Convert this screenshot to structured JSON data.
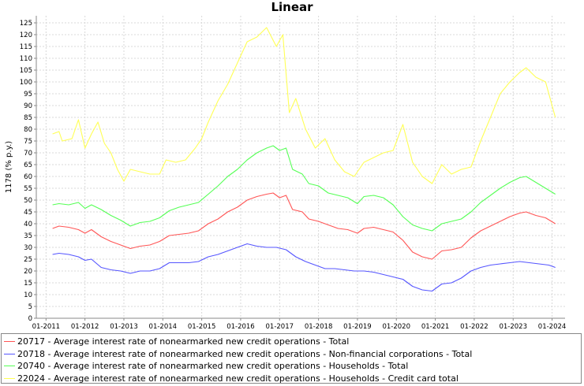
{
  "chart_data": {
    "type": "line",
    "title": "Linear",
    "xlabel": "",
    "ylabel": "1178 (% p.y.)",
    "ylim": [
      0,
      128
    ],
    "yticks": [
      0,
      5,
      10,
      15,
      20,
      25,
      30,
      35,
      40,
      45,
      50,
      55,
      60,
      65,
      70,
      75,
      80,
      85,
      90,
      95,
      100,
      105,
      110,
      115,
      120,
      125
    ],
    "xlim": [
      "2010-10",
      "2024-05"
    ],
    "xticks": [
      "01-2011",
      "01-2012",
      "01-2013",
      "01-2014",
      "01-2015",
      "01-2016",
      "01-2017",
      "01-2018",
      "01-2019",
      "01-2020",
      "01-2021",
      "01-2022",
      "01-2023",
      "01-2024"
    ],
    "grid": true,
    "legend_position": "bottom",
    "series": [
      {
        "name": "20717 - Average interest rate of nonearmarked new credit operations - Total",
        "color": "#ff5555",
        "points": [
          [
            "2011-03",
            38.0
          ],
          [
            "2011-05",
            39.0
          ],
          [
            "2011-08",
            38.5
          ],
          [
            "2011-11",
            37.5
          ],
          [
            "2012-01",
            36.0
          ],
          [
            "2012-03",
            37.5
          ],
          [
            "2012-06",
            34.5
          ],
          [
            "2012-09",
            32.5
          ],
          [
            "2012-12",
            31.0
          ],
          [
            "2013-03",
            29.5
          ],
          [
            "2013-06",
            30.5
          ],
          [
            "2013-09",
            31.0
          ],
          [
            "2013-12",
            32.5
          ],
          [
            "2014-03",
            35.0
          ],
          [
            "2014-06",
            35.5
          ],
          [
            "2014-09",
            36.0
          ],
          [
            "2014-12",
            37.0
          ],
          [
            "2015-03",
            40.0
          ],
          [
            "2015-06",
            42.0
          ],
          [
            "2015-09",
            45.0
          ],
          [
            "2015-12",
            47.0
          ],
          [
            "2016-03",
            50.0
          ],
          [
            "2016-06",
            51.5
          ],
          [
            "2016-09",
            52.5
          ],
          [
            "2016-11",
            53.0
          ],
          [
            "2017-01",
            51.0
          ],
          [
            "2017-03",
            52.0
          ],
          [
            "2017-05",
            46.0
          ],
          [
            "2017-08",
            45.0
          ],
          [
            "2017-10",
            42.0
          ],
          [
            "2018-01",
            41.0
          ],
          [
            "2018-04",
            39.5
          ],
          [
            "2018-07",
            38.0
          ],
          [
            "2018-10",
            37.5
          ],
          [
            "2019-01",
            36.0
          ],
          [
            "2019-03",
            38.0
          ],
          [
            "2019-06",
            38.5
          ],
          [
            "2019-09",
            37.5
          ],
          [
            "2019-12",
            36.5
          ],
          [
            "2020-03",
            33.0
          ],
          [
            "2020-06",
            28.0
          ],
          [
            "2020-09",
            26.0
          ],
          [
            "2020-12",
            25.0
          ],
          [
            "2021-03",
            28.5
          ],
          [
            "2021-06",
            29.0
          ],
          [
            "2021-09",
            30.0
          ],
          [
            "2021-12",
            34.0
          ],
          [
            "2022-03",
            37.0
          ],
          [
            "2022-06",
            39.0
          ],
          [
            "2022-09",
            41.0
          ],
          [
            "2022-12",
            43.0
          ],
          [
            "2023-03",
            44.5
          ],
          [
            "2023-05",
            45.0
          ],
          [
            "2023-08",
            43.5
          ],
          [
            "2023-11",
            42.5
          ],
          [
            "2024-02",
            40.0
          ]
        ]
      },
      {
        "name": "20718 - Average interest rate of nonearmarked new credit operations - Non-financial corporations - Total",
        "color": "#5555ff",
        "points": [
          [
            "2011-03",
            27.0
          ],
          [
            "2011-05",
            27.5
          ],
          [
            "2011-08",
            27.0
          ],
          [
            "2011-11",
            26.0
          ],
          [
            "2012-01",
            24.5
          ],
          [
            "2012-03",
            25.0
          ],
          [
            "2012-06",
            21.5
          ],
          [
            "2012-09",
            20.5
          ],
          [
            "2012-12",
            20.0
          ],
          [
            "2013-03",
            19.0
          ],
          [
            "2013-06",
            20.0
          ],
          [
            "2013-09",
            20.0
          ],
          [
            "2013-12",
            21.0
          ],
          [
            "2014-03",
            23.5
          ],
          [
            "2014-06",
            23.5
          ],
          [
            "2014-09",
            23.5
          ],
          [
            "2014-12",
            24.0
          ],
          [
            "2015-03",
            26.0
          ],
          [
            "2015-06",
            27.0
          ],
          [
            "2015-09",
            28.5
          ],
          [
            "2015-12",
            30.0
          ],
          [
            "2016-03",
            31.5
          ],
          [
            "2016-06",
            30.5
          ],
          [
            "2016-09",
            30.0
          ],
          [
            "2016-12",
            30.0
          ],
          [
            "2017-03",
            29.0
          ],
          [
            "2017-06",
            26.0
          ],
          [
            "2017-09",
            24.0
          ],
          [
            "2017-12",
            22.5
          ],
          [
            "2018-03",
            21.0
          ],
          [
            "2018-06",
            21.0
          ],
          [
            "2018-09",
            20.5
          ],
          [
            "2018-12",
            20.0
          ],
          [
            "2019-03",
            20.0
          ],
          [
            "2019-06",
            19.5
          ],
          [
            "2019-09",
            18.5
          ],
          [
            "2019-12",
            17.5
          ],
          [
            "2020-03",
            16.5
          ],
          [
            "2020-06",
            13.5
          ],
          [
            "2020-09",
            12.0
          ],
          [
            "2020-12",
            11.5
          ],
          [
            "2021-03",
            14.5
          ],
          [
            "2021-06",
            15.0
          ],
          [
            "2021-09",
            17.0
          ],
          [
            "2021-12",
            20.0
          ],
          [
            "2022-03",
            21.5
          ],
          [
            "2022-06",
            22.5
          ],
          [
            "2022-09",
            23.0
          ],
          [
            "2022-12",
            23.5
          ],
          [
            "2023-03",
            24.0
          ],
          [
            "2023-06",
            23.5
          ],
          [
            "2023-09",
            23.0
          ],
          [
            "2023-12",
            22.5
          ],
          [
            "2024-02",
            21.5
          ]
        ]
      },
      {
        "name": "20740 - Average interest rate of nonearmarked new credit operations - Households - Total",
        "color": "#55ff55",
        "points": [
          [
            "2011-03",
            48.0
          ],
          [
            "2011-05",
            48.5
          ],
          [
            "2011-08",
            48.0
          ],
          [
            "2011-11",
            49.0
          ],
          [
            "2012-01",
            46.5
          ],
          [
            "2012-03",
            48.0
          ],
          [
            "2012-06",
            46.0
          ],
          [
            "2012-09",
            43.5
          ],
          [
            "2012-12",
            41.5
          ],
          [
            "2013-03",
            39.0
          ],
          [
            "2013-06",
            40.5
          ],
          [
            "2013-09",
            41.0
          ],
          [
            "2013-12",
            42.5
          ],
          [
            "2014-03",
            45.5
          ],
          [
            "2014-06",
            47.0
          ],
          [
            "2014-09",
            48.0
          ],
          [
            "2014-12",
            49.0
          ],
          [
            "2015-03",
            52.5
          ],
          [
            "2015-06",
            56.0
          ],
          [
            "2015-09",
            60.0
          ],
          [
            "2015-12",
            63.0
          ],
          [
            "2016-03",
            67.0
          ],
          [
            "2016-06",
            70.0
          ],
          [
            "2016-09",
            72.0
          ],
          [
            "2016-11",
            73.0
          ],
          [
            "2017-01",
            71.0
          ],
          [
            "2017-03",
            72.0
          ],
          [
            "2017-05",
            63.0
          ],
          [
            "2017-08",
            61.0
          ],
          [
            "2017-10",
            57.0
          ],
          [
            "2018-01",
            56.0
          ],
          [
            "2018-04",
            53.0
          ],
          [
            "2018-07",
            52.0
          ],
          [
            "2018-10",
            51.0
          ],
          [
            "2019-01",
            48.5
          ],
          [
            "2019-03",
            51.5
          ],
          [
            "2019-06",
            52.0
          ],
          [
            "2019-09",
            51.0
          ],
          [
            "2019-12",
            48.0
          ],
          [
            "2020-03",
            43.0
          ],
          [
            "2020-06",
            39.5
          ],
          [
            "2020-09",
            38.0
          ],
          [
            "2020-12",
            37.0
          ],
          [
            "2021-03",
            40.0
          ],
          [
            "2021-06",
            41.0
          ],
          [
            "2021-09",
            42.0
          ],
          [
            "2021-12",
            45.0
          ],
          [
            "2022-03",
            49.0
          ],
          [
            "2022-06",
            52.0
          ],
          [
            "2022-09",
            55.0
          ],
          [
            "2022-12",
            57.5
          ],
          [
            "2023-03",
            59.5
          ],
          [
            "2023-05",
            60.0
          ],
          [
            "2023-08",
            57.5
          ],
          [
            "2023-11",
            55.0
          ],
          [
            "2024-02",
            52.5
          ]
        ]
      },
      {
        "name": "22024 - Average interest rate of nonearmarked new credit operations - Households - Credit card total",
        "color": "#ffff55",
        "points": [
          [
            "2011-03",
            78.0
          ],
          [
            "2011-05",
            79.0
          ],
          [
            "2011-06",
            75.0
          ],
          [
            "2011-09",
            76.0
          ],
          [
            "2011-11",
            84.0
          ],
          [
            "2012-01",
            72.0
          ],
          [
            "2012-03",
            78.0
          ],
          [
            "2012-05",
            83.0
          ],
          [
            "2012-07",
            74.0
          ],
          [
            "2012-09",
            70.0
          ],
          [
            "2012-11",
            63.0
          ],
          [
            "2013-01",
            58.0
          ],
          [
            "2013-03",
            63.0
          ],
          [
            "2013-06",
            62.0
          ],
          [
            "2013-09",
            61.0
          ],
          [
            "2013-12",
            61.0
          ],
          [
            "2014-02",
            67.0
          ],
          [
            "2014-05",
            66.0
          ],
          [
            "2014-08",
            67.0
          ],
          [
            "2014-11",
            72.0
          ],
          [
            "2015-01",
            76.0
          ],
          [
            "2015-03",
            83.0
          ],
          [
            "2015-06",
            92.0
          ],
          [
            "2015-09",
            99.0
          ],
          [
            "2015-12",
            108.0
          ],
          [
            "2016-03",
            117.0
          ],
          [
            "2016-06",
            119.0
          ],
          [
            "2016-09",
            123.0
          ],
          [
            "2016-12",
            115.0
          ],
          [
            "2017-02",
            120.0
          ],
          [
            "2017-04",
            87.0
          ],
          [
            "2017-06",
            93.0
          ],
          [
            "2017-09",
            80.0
          ],
          [
            "2017-12",
            72.0
          ],
          [
            "2018-03",
            76.0
          ],
          [
            "2018-06",
            67.0
          ],
          [
            "2018-09",
            62.0
          ],
          [
            "2018-12",
            60.0
          ],
          [
            "2019-03",
            66.0
          ],
          [
            "2019-06",
            68.0
          ],
          [
            "2019-09",
            70.0
          ],
          [
            "2019-12",
            71.0
          ],
          [
            "2020-03",
            82.0
          ],
          [
            "2020-06",
            66.0
          ],
          [
            "2020-09",
            60.0
          ],
          [
            "2020-12",
            57.0
          ],
          [
            "2021-03",
            65.0
          ],
          [
            "2021-06",
            61.0
          ],
          [
            "2021-09",
            63.0
          ],
          [
            "2021-12",
            64.0
          ],
          [
            "2022-03",
            75.0
          ],
          [
            "2022-06",
            85.0
          ],
          [
            "2022-09",
            95.0
          ],
          [
            "2022-12",
            100.0
          ],
          [
            "2023-03",
            104.0
          ],
          [
            "2023-05",
            106.0
          ],
          [
            "2023-08",
            102.0
          ],
          [
            "2023-11",
            100.0
          ],
          [
            "2024-02",
            85.0
          ]
        ]
      }
    ]
  }
}
